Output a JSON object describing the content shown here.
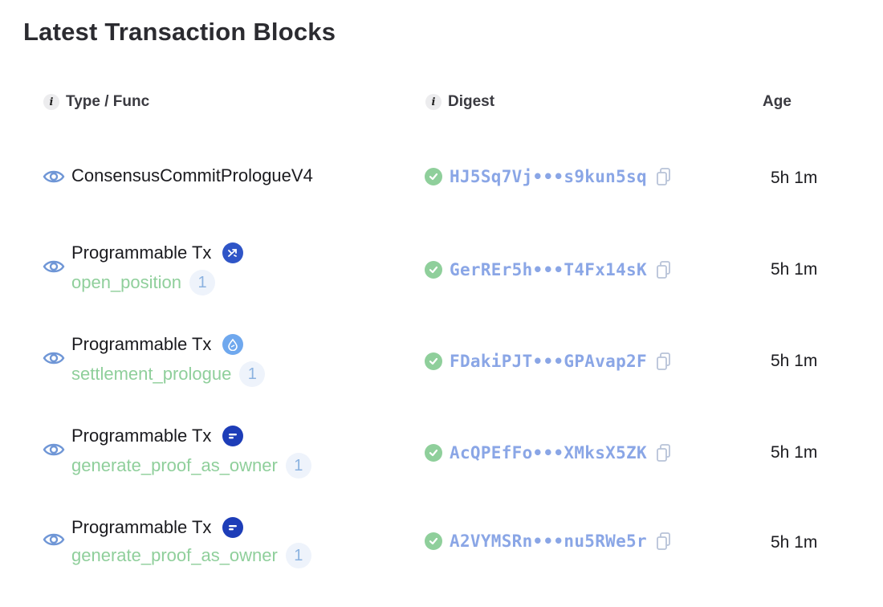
{
  "section_title": "Latest Transaction Blocks",
  "columns": {
    "type_func": "Type / Func",
    "digest": "Digest",
    "age": "Age"
  },
  "colors": {
    "success": "#8fcf9b",
    "digest_link": "#8aa6e6",
    "function_name": "#8fcf9b",
    "eye_icon": "#6f96d6"
  },
  "rows": [
    {
      "type": "ConsensusCommitPrologueV4",
      "function": null,
      "call_count": null,
      "package_icon": null,
      "status_icon": "success-check-icon",
      "digest": "HJ5Sq7Vj•••s9kun5sq",
      "age": "5h 1m"
    },
    {
      "type": "Programmable Tx",
      "function": "open_position",
      "call_count": "1",
      "package_icon": "swap-package-icon",
      "status_icon": "success-check-icon",
      "digest": "GerREr5h•••T4Fx14sK",
      "age": "5h 1m"
    },
    {
      "type": "Programmable Tx",
      "function": "settlement_prologue",
      "call_count": "1",
      "package_icon": "droplet-package-icon",
      "status_icon": "success-check-icon",
      "digest": "FDakiPJT•••GPAvap2F",
      "age": "5h 1m"
    },
    {
      "type": "Programmable Tx",
      "function": "generate_proof_as_owner",
      "call_count": "1",
      "package_icon": "proof-package-icon",
      "status_icon": "success-check-icon",
      "digest": "AcQPEfFo•••XMksX5ZK",
      "age": "5h 1m"
    },
    {
      "type": "Programmable Tx",
      "function": "generate_proof_as_owner",
      "call_count": "1",
      "package_icon": "proof-package-icon",
      "status_icon": "success-check-icon",
      "digest": "A2VYMSRn•••nu5RWe5r",
      "age": "5h 1m"
    }
  ]
}
